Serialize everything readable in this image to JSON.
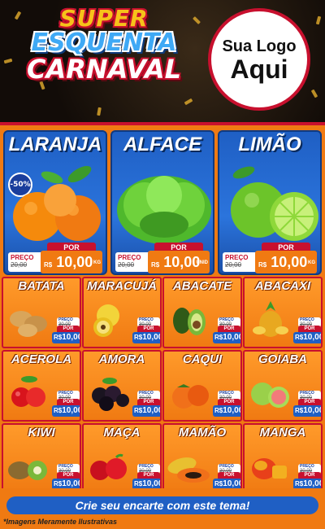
{
  "header": {
    "title_line1": "SUPER",
    "title_line2": "ESQUENTA",
    "title_line3": "CARNAVAL",
    "logo_line1": "Sua Logo",
    "logo_line2": "Aqui"
  },
  "price_labels": {
    "preco": "PREÇO",
    "por": "POR",
    "rs": "R$",
    "kg": "KG",
    "unid": "UNID"
  },
  "featured": [
    {
      "name": "LARANJA",
      "old_price": "20,00",
      "new_price": "10,00",
      "unit": "KG",
      "discount": "-50%"
    },
    {
      "name": "ALFACE",
      "old_price": "20,00",
      "new_price": "10,00",
      "unit": "UNID"
    },
    {
      "name": "LIMÃO",
      "old_price": "20,00",
      "new_price": "10,00",
      "unit": "KG"
    }
  ],
  "products": [
    {
      "name": "BATATA",
      "old_price": "30,00",
      "new_price": "10,00"
    },
    {
      "name": "MARACUJÁ",
      "old_price": "30,00",
      "new_price": "10,00"
    },
    {
      "name": "ABACATE",
      "old_price": "30,00",
      "new_price": "10,00"
    },
    {
      "name": "ABACAXI",
      "old_price": "30,00",
      "new_price": "10,00"
    },
    {
      "name": "ACEROLA",
      "old_price": "30,00",
      "new_price": "10,00"
    },
    {
      "name": "AMORA",
      "old_price": "30,00",
      "new_price": "10,00"
    },
    {
      "name": "CAQUI",
      "old_price": "30,00",
      "new_price": "10,00"
    },
    {
      "name": "GOIABA",
      "old_price": "30,00",
      "new_price": "10,00"
    },
    {
      "name": "KIWI",
      "old_price": "30,00",
      "new_price": "10,00"
    },
    {
      "name": "MAÇA",
      "old_price": "30,00",
      "new_price": "10,00"
    },
    {
      "name": "MAMÃO",
      "old_price": "30,00",
      "new_price": "10,00"
    },
    {
      "name": "MANGA",
      "old_price": "30,00",
      "new_price": "10,00"
    }
  ],
  "cta": "Crie seu encarte com este tema!",
  "disclaimer": "*Imagens Meramente Ilustrativas",
  "colors": {
    "orange": "#f07a12",
    "blue": "#1f5fc4",
    "red": "#c8102e",
    "gold": "#f7c21a"
  }
}
